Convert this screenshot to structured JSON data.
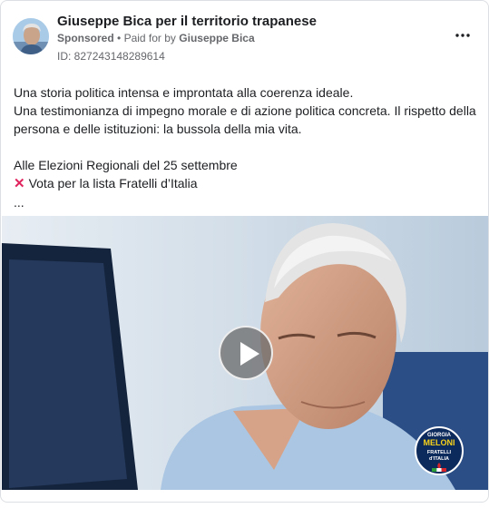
{
  "post": {
    "page_name": "Giuseppe Bica per il territorio trapanese",
    "sponsored": "Sponsored",
    "separator": "•",
    "paid_for_prefix": "Paid for by",
    "paid_for_name": "Giuseppe Bica",
    "ad_id": "ID: 827243148289614",
    "more_icon": "more-horizontal-icon",
    "body_lines": [
      "Una storia politica intensa e improntata alla coerenza ideale.",
      "Una testimonianza di impegno morale e di azione politica concreta. Il rispetto della persona e delle istituzioni: la bussola della mia vita."
    ],
    "election_line": "Alle Elezioni Regionali del 25 settembre",
    "vote_line": "Vota per la lista Fratelli d’Italia",
    "vote_icon": "red-x-icon",
    "ellipsis": "..."
  },
  "media": {
    "type": "video",
    "play_icon": "play-icon",
    "logo": {
      "line1": "GIORGIA",
      "line2": "MELONI",
      "line3": "FRATELLI",
      "line4": "d'ITALIA"
    }
  },
  "colors": {
    "text_primary": "#1c1e21",
    "text_secondary": "#65676b",
    "vote_x": "#e0245e",
    "logo_bg": "#0d2a5c",
    "logo_accent": "#f7d21a"
  }
}
